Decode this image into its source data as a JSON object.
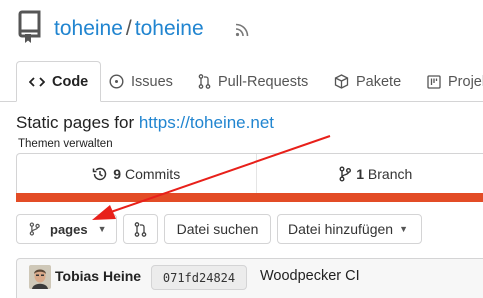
{
  "repo": {
    "owner": "toheine",
    "separator": "/",
    "name": "toheine"
  },
  "tabs": [
    {
      "label": "Code",
      "icon": "code-icon",
      "active": true
    },
    {
      "label": "Issues",
      "icon": "issue-icon",
      "active": false
    },
    {
      "label": "Pull-Requests",
      "icon": "pull-request-icon",
      "active": false
    },
    {
      "label": "Pakete",
      "icon": "package-icon",
      "active": false
    },
    {
      "label": "Projekte",
      "icon": "project-icon",
      "active": false
    }
  ],
  "description": {
    "text": "Static pages for ",
    "link": "https://toheine.net"
  },
  "topics_link": "Themen verwalten",
  "stats": {
    "commits_count": "9",
    "commits_label": "Commits",
    "branches_count": "1",
    "branches_label": "Branch"
  },
  "language_bar_color": "#e34c26",
  "toolbar": {
    "branch": "pages",
    "find_file": "Datei suchen",
    "add_file": "Datei hinzufügen"
  },
  "last_commit": {
    "author": "Tobias Heine",
    "sha": "071fd24824",
    "message": "Woodpecker CI"
  },
  "colors": {
    "link": "#2185d0",
    "annotation_arrow": "#e8201a"
  }
}
